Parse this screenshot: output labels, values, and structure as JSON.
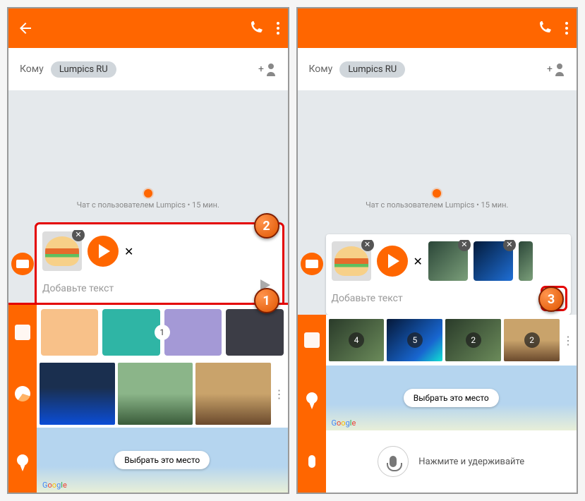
{
  "header": {
    "to_label": "Кому",
    "recipient": "Lumpics RU"
  },
  "conversation": {
    "status": "Чат с пользователем Lumpics • 15 мин."
  },
  "compose": {
    "placeholder": "Добавьте текст",
    "send_type": "MMS"
  },
  "map": {
    "select_label": "Выбрать это место",
    "provider": "Google"
  },
  "voice": {
    "hint": "Нажмите и удерживайте"
  },
  "gallery": {
    "counts": [
      "1",
      "4",
      "5",
      "2",
      "2"
    ]
  },
  "badges": {
    "one": "1",
    "two": "2",
    "three": "3"
  }
}
